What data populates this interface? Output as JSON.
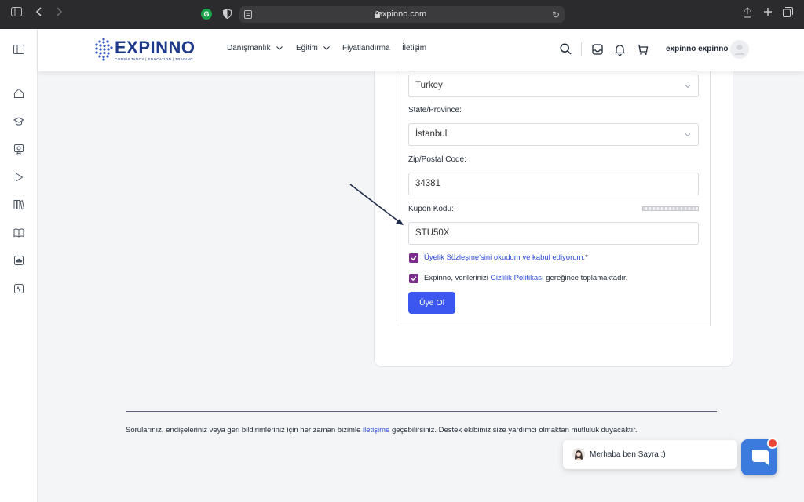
{
  "browser": {
    "url": "expinno.com"
  },
  "header": {
    "logo_text": "EXPINNO",
    "logo_tagline": "CONSULTANCY | EDUCATION | TRADING",
    "nav": [
      {
        "label": "Danışmanlık",
        "has_dropdown": true
      },
      {
        "label": "Eğitim",
        "has_dropdown": true
      },
      {
        "label": "Fiyatlandırma",
        "has_dropdown": false
      },
      {
        "label": "İletişim",
        "has_dropdown": false
      }
    ],
    "user_name": "expinno expinno"
  },
  "form": {
    "country_value": "Turkey",
    "state_label": "State/Province:",
    "state_value": "İstanbul",
    "zip_label": "Zip/Postal Code:",
    "zip_value": "34381",
    "coupon_label": "Kupon Kodu:",
    "coupon_value": "STU50X",
    "terms_link": "Üyelik Sözleşme'sini okudum ve kabul ediyorum.",
    "terms_required": "*",
    "privacy_prefix": "Expinno, verilerinizi ",
    "privacy_link": "Gizlilik Politikası",
    "privacy_suffix": " gereğince toplamaktadır.",
    "terms_checked": true,
    "privacy_checked": true,
    "submit_label": "Üye Ol"
  },
  "footer": {
    "text_before": "Sorularınız, endişeleriniz veya geri bildirimleriniz için her zaman bizimle ",
    "link": "iletişime",
    "text_after": " geçebilirsiniz. Destek ekibimiz size yardımcı olmaktan mutluluk duyacaktır."
  },
  "chat": {
    "message": "Merhaba ben Sayra :)"
  },
  "colors": {
    "primary_button": "#3b57ef",
    "link": "#2c4bd9",
    "checkbox": "#7b2d8b",
    "chat_launcher": "#3b7bdd",
    "chat_badge": "#f04438"
  }
}
